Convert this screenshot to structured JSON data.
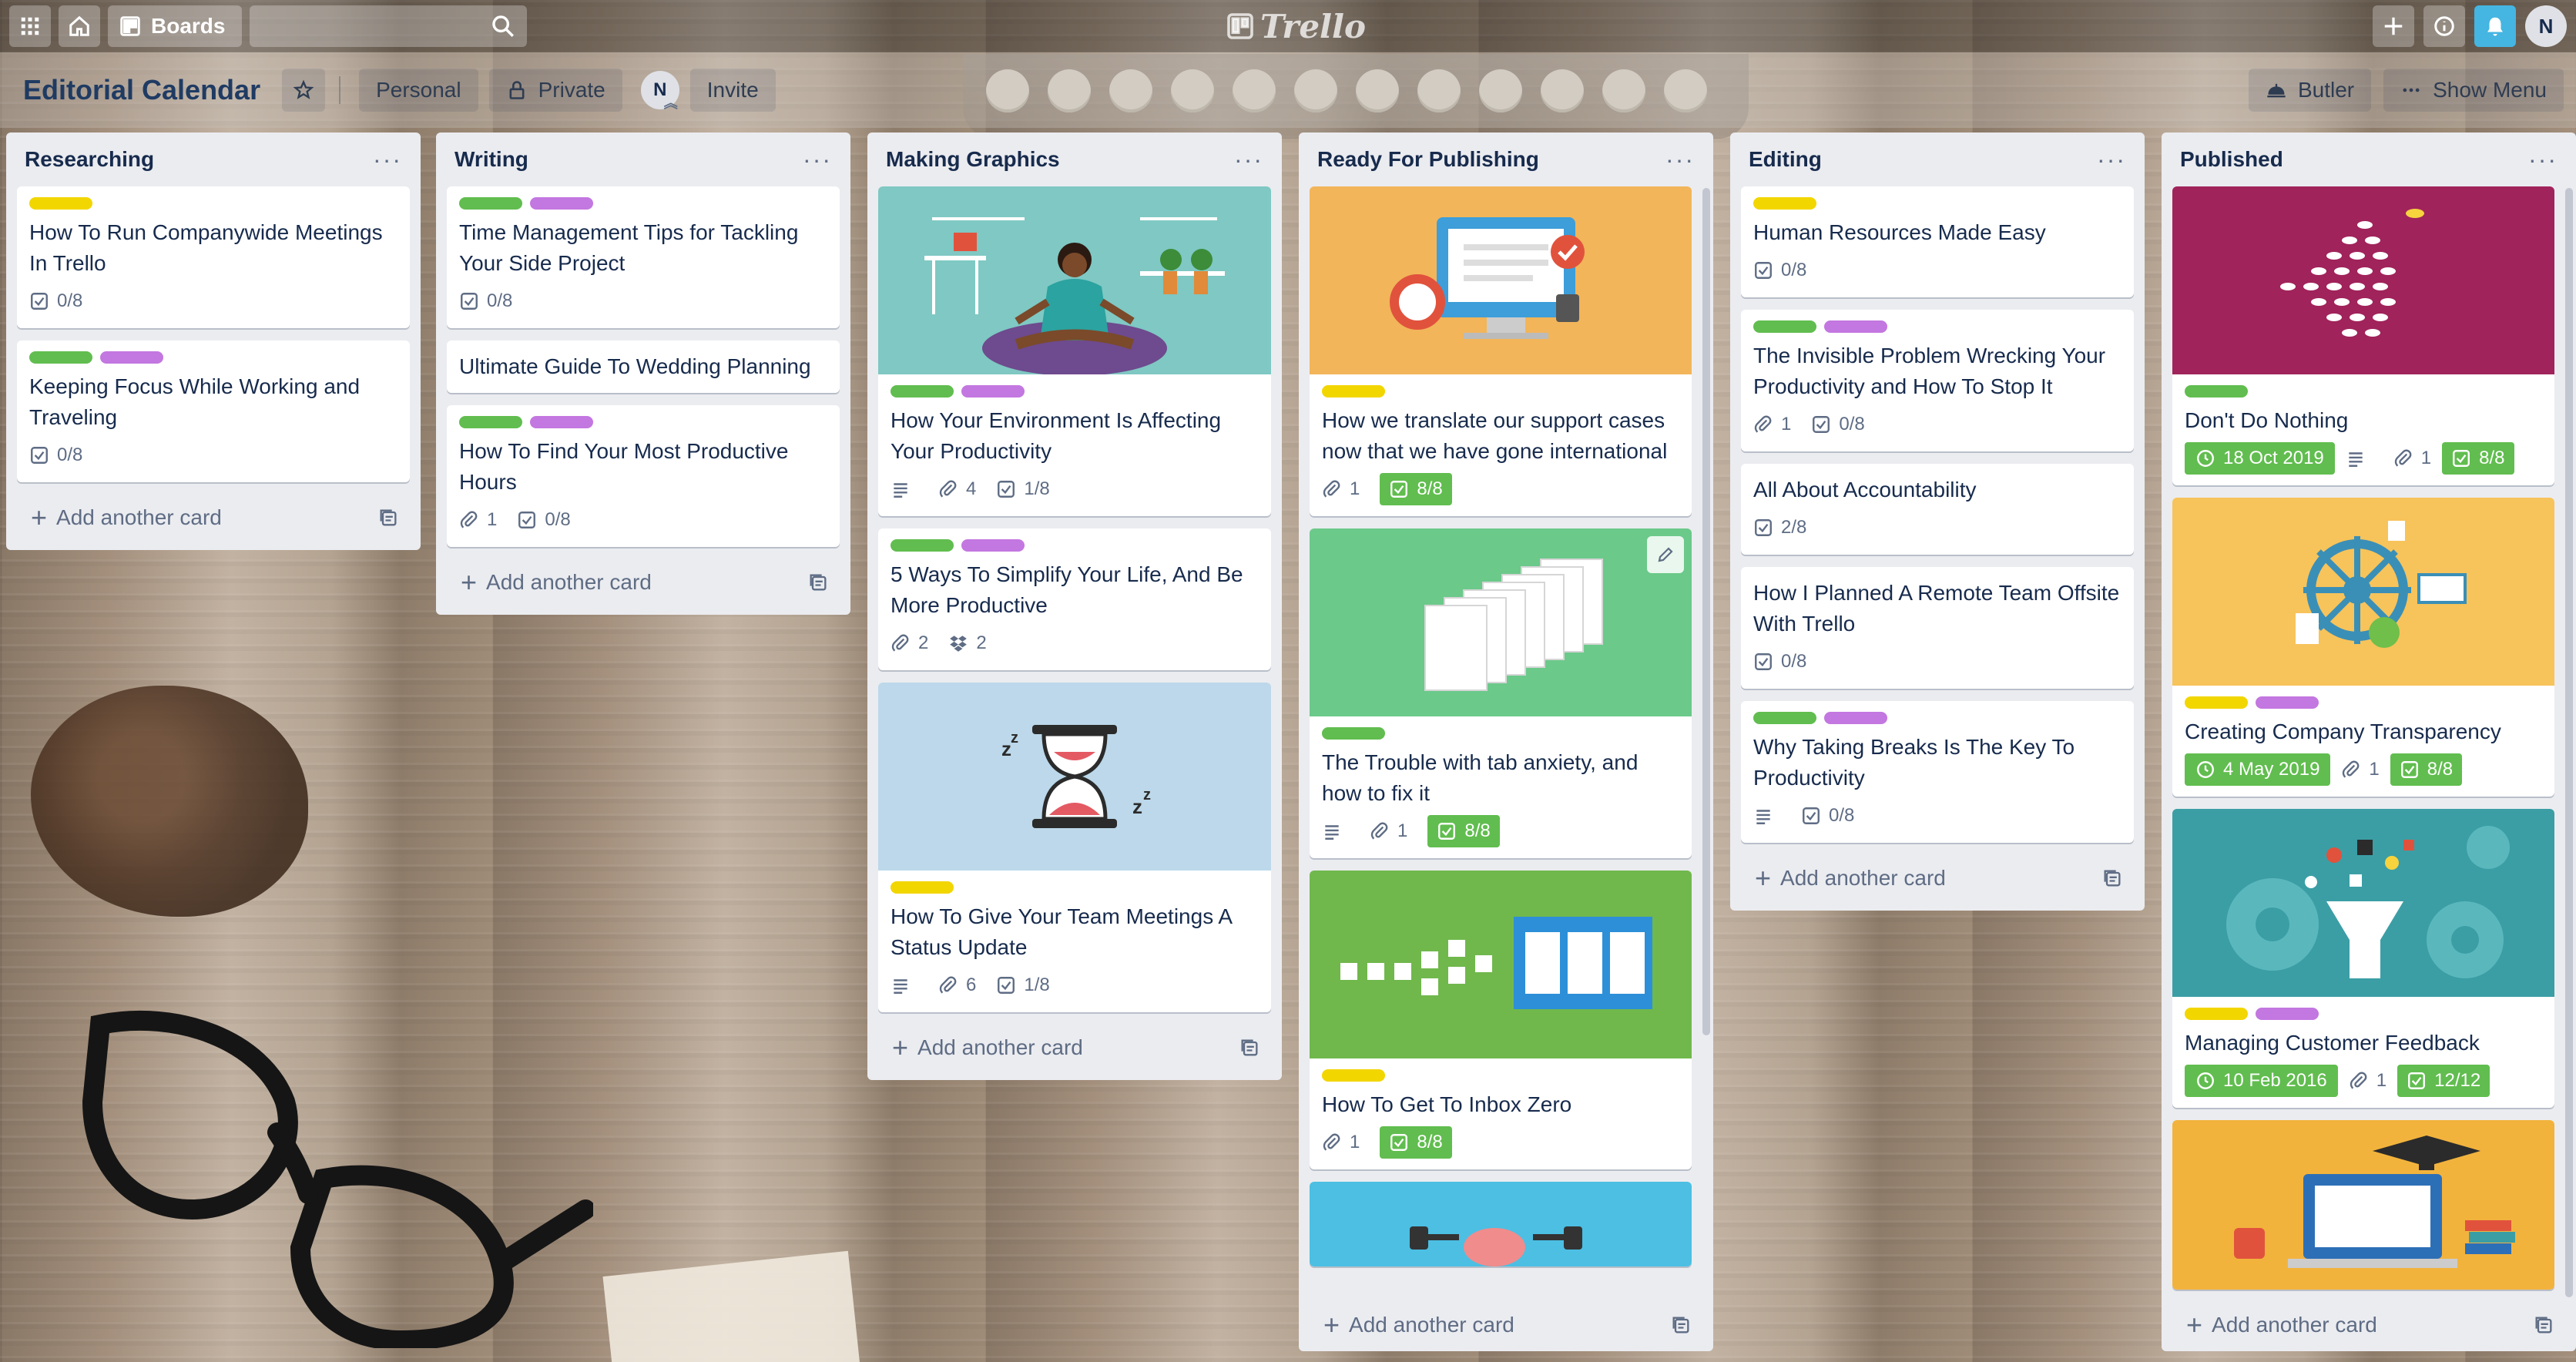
{
  "header": {
    "boards_label": "Boards",
    "logo_text": "Trello",
    "avatar_initial": "N"
  },
  "board": {
    "title": "Editorial Calendar",
    "team_label": "Personal",
    "visibility_label": "Private",
    "member_initial": "N",
    "invite_label": "Invite",
    "butler_label": "Butler",
    "show_menu_label": "Show Menu"
  },
  "common": {
    "add_card_label": "Add another card",
    "list_menu": "···"
  },
  "colors": {
    "label_yellow": "#f2d600",
    "label_green": "#61bd4f",
    "label_purple": "#c377e0",
    "list_bg": "#ebecf0",
    "notification_blue": "#45b5e2"
  },
  "lists": [
    {
      "title": "Researching",
      "cards": [
        {
          "title": "How To Run Companywide Meetings In Trello",
          "labels": [
            "yellow"
          ],
          "checklist": "0/8"
        },
        {
          "title": "Keeping Focus While Working and Traveling",
          "labels": [
            "green",
            "purple"
          ],
          "checklist": "0/8"
        }
      ]
    },
    {
      "title": "Writing",
      "cards": [
        {
          "title": "Time Management Tips for Tackling Your Side Project",
          "labels": [
            "green",
            "purple"
          ],
          "checklist": "0/8"
        },
        {
          "title": "Ultimate Guide To Wedding Planning",
          "labels": []
        },
        {
          "title": "How To Find Your Most Productive Hours",
          "labels": [
            "green",
            "purple"
          ],
          "attachments": "1",
          "checklist": "0/8"
        }
      ]
    },
    {
      "title": "Making Graphics",
      "cards": [
        {
          "title": "How Your Environment Is Affecting Your Productivity",
          "cover": "meditation-illustration",
          "labels": [
            "green",
            "purple"
          ],
          "attachments": "4",
          "checklist": "1/8"
        },
        {
          "title": "5 Ways To Simplify Your Life, And Be More Productive",
          "labels": [
            "green",
            "purple"
          ],
          "attachments": "2",
          "dropbox": "2"
        },
        {
          "title": "How To Give Your Team Meetings A Status Update",
          "cover": "hourglass-illustration",
          "labels": [
            "yellow"
          ],
          "attachments": "6",
          "checklist": "1/8"
        }
      ]
    },
    {
      "title": "Ready For Publishing",
      "cards": [
        {
          "title": "How we translate our support cases now that we have gone international",
          "cover": "support-illustration",
          "labels": [
            "yellow"
          ],
          "attachments": "1",
          "checklist": "8/8"
        },
        {
          "title": "The Trouble with tab anxiety, and how to fix it",
          "cover": "tabs-illustration",
          "labels": [
            "green"
          ],
          "attachments": "1",
          "checklist": "8/8"
        },
        {
          "title": "How To Get To Inbox Zero",
          "cover": "inbox-illustration",
          "labels": [
            "yellow"
          ],
          "attachments": "1",
          "checklist": "8/8"
        }
      ]
    },
    {
      "title": "Editing",
      "cards": [
        {
          "title": "Human Resources Made Easy",
          "labels": [
            "yellow"
          ],
          "checklist": "0/8"
        },
        {
          "title": "The Invisible Problem Wrecking Your Productivity and How To Stop It",
          "labels": [
            "green",
            "purple"
          ],
          "attachments": "1",
          "checklist": "0/8"
        },
        {
          "title": "All About Accountability",
          "labels": [],
          "checklist": "2/8"
        },
        {
          "title": "How I Planned A Remote Team Offsite With Trello",
          "labels": [],
          "checklist": "0/8"
        },
        {
          "title": "Why Taking Breaks Is The Key To Productivity",
          "labels": [
            "green",
            "purple"
          ],
          "checklist": "0/8"
        }
      ]
    },
    {
      "title": "Published",
      "cards": [
        {
          "title": "Don't Do Nothing",
          "cover": "fish-illustration",
          "labels": [
            "green"
          ],
          "due": "18 Oct 2019",
          "attachments": "1",
          "checklist": "8/8"
        },
        {
          "title": "Creating Company Transparency",
          "cover": "compass-illustration",
          "labels": [
            "yellow",
            "purple"
          ],
          "due": "4 May 2019",
          "attachments": "1",
          "checklist": "8/8"
        },
        {
          "title": "Managing Customer Feedback",
          "cover": "gears-illustration",
          "labels": [
            "yellow",
            "purple"
          ],
          "due": "10 Feb 2016",
          "attachments": "1",
          "checklist": "12/12"
        }
      ]
    }
  ]
}
